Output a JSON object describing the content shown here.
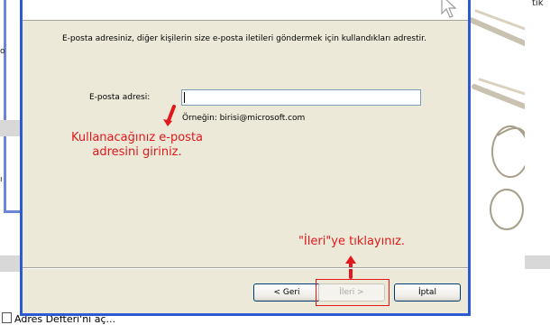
{
  "dialog": {
    "description": "E-posta adresiniz, diğer kişilerin size e-posta iletileri göndermek için kullandıkları adrestir.",
    "email_label": "E-posta adresi:",
    "email_value": "",
    "example_text": "Örneğin: birisi@microsoft.com",
    "buttons": {
      "back": "< Geri",
      "next": "İleri >",
      "cancel": "İptal"
    }
  },
  "annotations": {
    "enter_email": "Kullanacağınız e-posta adresini giriniz.",
    "click_next": "\"İleri\"ye tıklayınız."
  },
  "background": {
    "right_top_fragment": "tık",
    "left_fragments": [
      "o",
      "ı"
    ],
    "taskbar_item": "Adres Defteri'ni aç..."
  },
  "colors": {
    "dialog_bg": "#ece9d8",
    "dialog_border": "#2b5ad2",
    "annotation_red": "#e0181b"
  }
}
